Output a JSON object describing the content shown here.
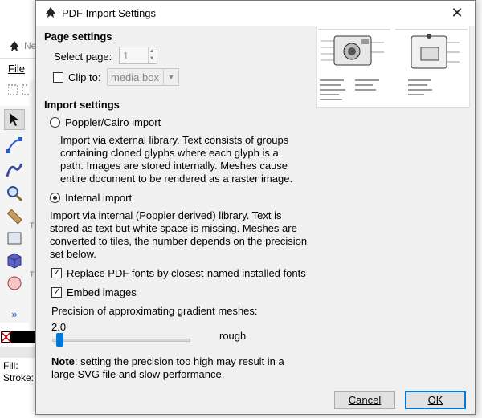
{
  "background": {
    "title_partial": "Ne",
    "menu_file": "File",
    "ruler_mark": "T",
    "more_tools": "»",
    "fill_label": "Fill:",
    "stroke_label": "Stroke:"
  },
  "dialog": {
    "title": "PDF Import Settings",
    "close_glyph": "✕",
    "page_settings": {
      "heading": "Page settings",
      "select_page_label": "Select page:",
      "select_page_value": "1",
      "clip_to_label": "Clip to:",
      "clip_to_checked": false,
      "clip_to_value": "media box"
    },
    "import_settings": {
      "heading": "Import settings",
      "poppler_label": "Poppler/Cairo import",
      "poppler_selected": false,
      "poppler_desc": "Import via external library. Text consists of groups containing cloned glyphs where each glyph is a path. Images are stored internally. Meshes cause entire document to be rendered as a raster image.",
      "internal_label": "Internal import",
      "internal_selected": true,
      "internal_desc": "Import via internal (Poppler derived) library. Text is stored as text but white space is missing. Meshes are converted to tiles, the number depends on the precision set below.",
      "replace_fonts_label": "Replace PDF fonts by closest-named installed fonts",
      "replace_fonts_checked": true,
      "embed_images_label": "Embed images",
      "embed_images_checked": true,
      "precision_label": "Precision of approximating gradient meshes:",
      "precision_value": "2.0",
      "precision_fraction": 0.02,
      "precision_quality": "rough",
      "note_bold": "Note",
      "note_text": ": setting the precision too high may result in a large SVG file and slow performance."
    },
    "buttons": {
      "cancel": "Cancel",
      "ok": "OK"
    },
    "colors": {
      "accent": "#0078d7"
    }
  }
}
